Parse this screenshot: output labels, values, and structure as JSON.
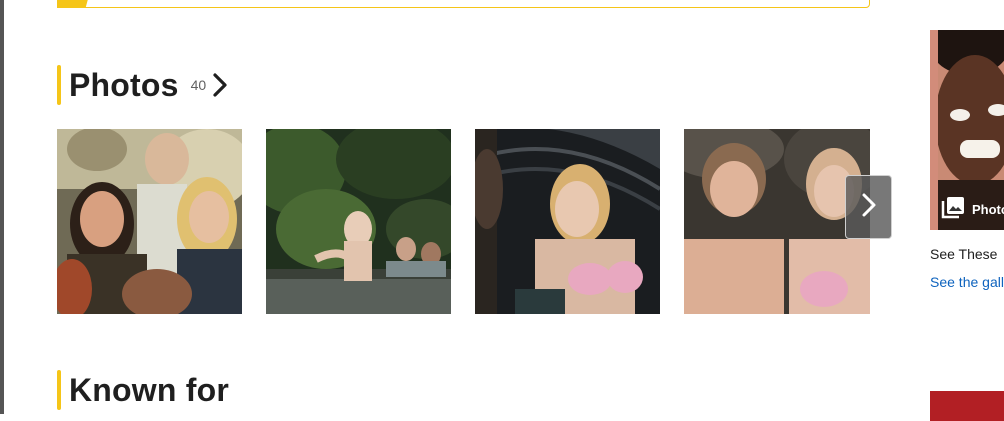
{
  "photos_section": {
    "title": "Photos",
    "count": "40",
    "items": [
      {
        "alt": "photo-1"
      },
      {
        "alt": "photo-2"
      },
      {
        "alt": "photo-3"
      },
      {
        "alt": "photo-4"
      }
    ],
    "next_icon": "chevron-right-icon"
  },
  "known_for_section": {
    "title": "Known for"
  },
  "sidebar": {
    "badge_label": "Photos",
    "title": "See These",
    "link": "See the gallery"
  },
  "colors": {
    "accent": "#f5c518",
    "link": "#0e63be"
  }
}
